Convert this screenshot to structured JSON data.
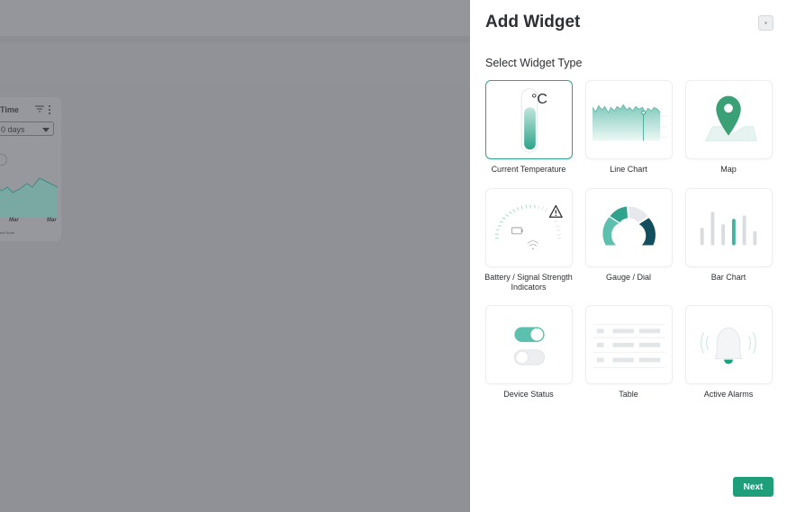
{
  "background": {
    "card_title": "Time",
    "range_select_value": "0 days",
    "x_ticks": [
      "Mar",
      "Mar"
    ],
    "footer_text": "ent Store"
  },
  "drawer": {
    "title": "Add Widget",
    "section_label": "Select Widget Type",
    "close_icon": "close-icon",
    "next_label": "Next",
    "accent_color": "#2fa38b",
    "widgets": [
      {
        "label": "Current Temperature",
        "icon": "thermometer-icon",
        "unit": "°C",
        "selected": true
      },
      {
        "label": "Line Chart",
        "icon": "line-chart-icon"
      },
      {
        "label": "Map",
        "icon": "map-pin-icon"
      },
      {
        "label": "Battery / Signal Strength Indicators",
        "icon": "battery-signal-icon"
      },
      {
        "label": "Gauge / Dial",
        "icon": "gauge-icon"
      },
      {
        "label": "Bar Chart",
        "icon": "bar-chart-icon"
      },
      {
        "label": "Device Status",
        "icon": "toggle-switch-icon"
      },
      {
        "label": "Table",
        "icon": "table-icon"
      },
      {
        "label": "Active Alarms",
        "icon": "alarm-bell-icon"
      }
    ]
  }
}
